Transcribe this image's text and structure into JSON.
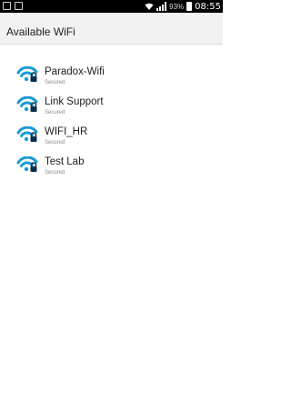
{
  "status_bar": {
    "battery": "93%",
    "time": "08:55",
    "icons": [
      "image-notification-icon",
      "sim-notification-icon",
      "wifi-status-icon",
      "signal-icon",
      "battery-icon"
    ]
  },
  "header": {
    "title": "Available WiFi"
  },
  "networks": [
    {
      "ssid": "Paradox-Wifi",
      "security": "Secured"
    },
    {
      "ssid": "Link Support",
      "security": "Secured"
    },
    {
      "ssid": "WIFI_HR",
      "security": "Secured"
    },
    {
      "ssid": "Test Lab",
      "security": "Secured"
    }
  ],
  "colors": {
    "wifi_icon": "#1a9ad6",
    "status_bar": "#000000",
    "header_bg": "#f2f2f2"
  }
}
